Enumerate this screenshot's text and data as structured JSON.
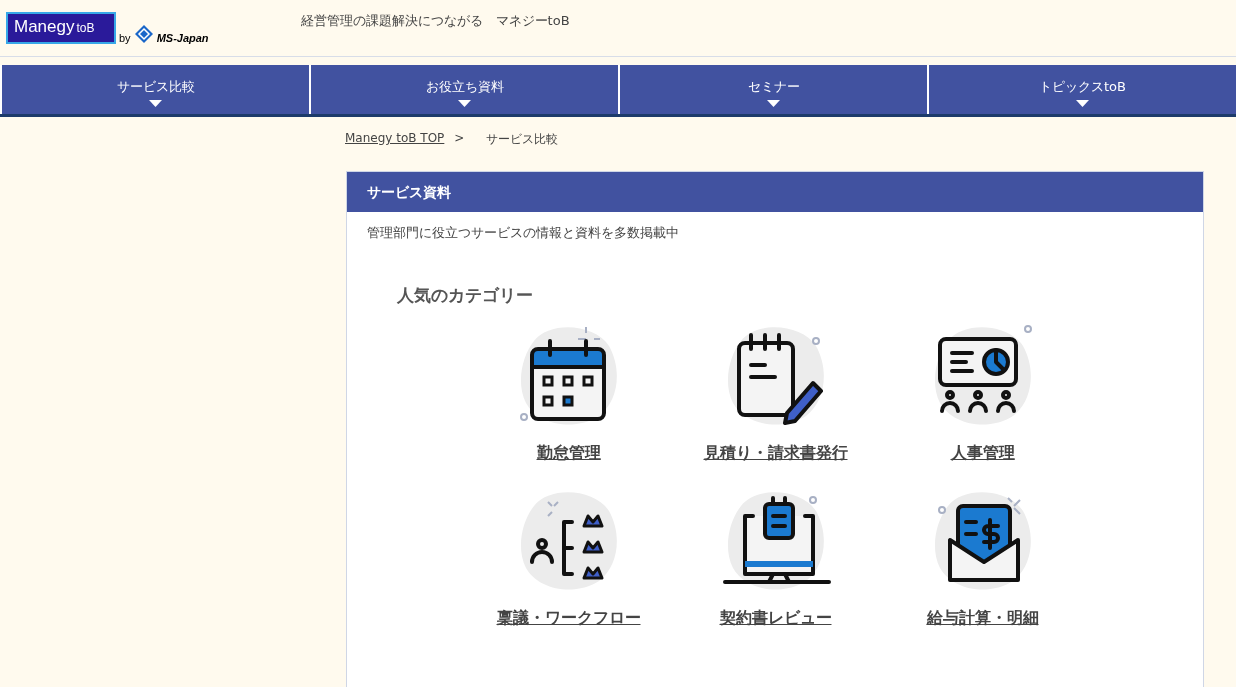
{
  "header": {
    "logo": {
      "main": "Manegy",
      "sub": "toB",
      "by": "by",
      "company": "MS-Japan"
    },
    "tagline": "経営管理の課題解決につながる　マネジーtoB"
  },
  "nav": [
    {
      "label": "サービス比較"
    },
    {
      "label": "お役立ち資料"
    },
    {
      "label": "セミナー"
    },
    {
      "label": "トピックスtoB"
    }
  ],
  "breadcrumb": [
    {
      "label": "Manegy toB TOP ",
      "link": true,
      "separator": ">"
    },
    {
      "label": "サービス比較",
      "link": false
    }
  ],
  "panel": {
    "title": "サービス資料",
    "description": "管理部門に役立つサービスの情報と資料を多数掲載中",
    "section_title": "人気のカテゴリー",
    "categories": [
      {
        "label": "勤怠管理",
        "kind": "calendar"
      },
      {
        "label": "見積り・請求書発行",
        "kind": "invoice"
      },
      {
        "label": "人事管理",
        "kind": "presentation"
      },
      {
        "label": "稟議・ワークフロー",
        "kind": "workflow"
      },
      {
        "label": "契約書レビュー",
        "kind": "monitor"
      },
      {
        "label": "給与計算・明細",
        "kind": "payslip"
      }
    ]
  }
}
